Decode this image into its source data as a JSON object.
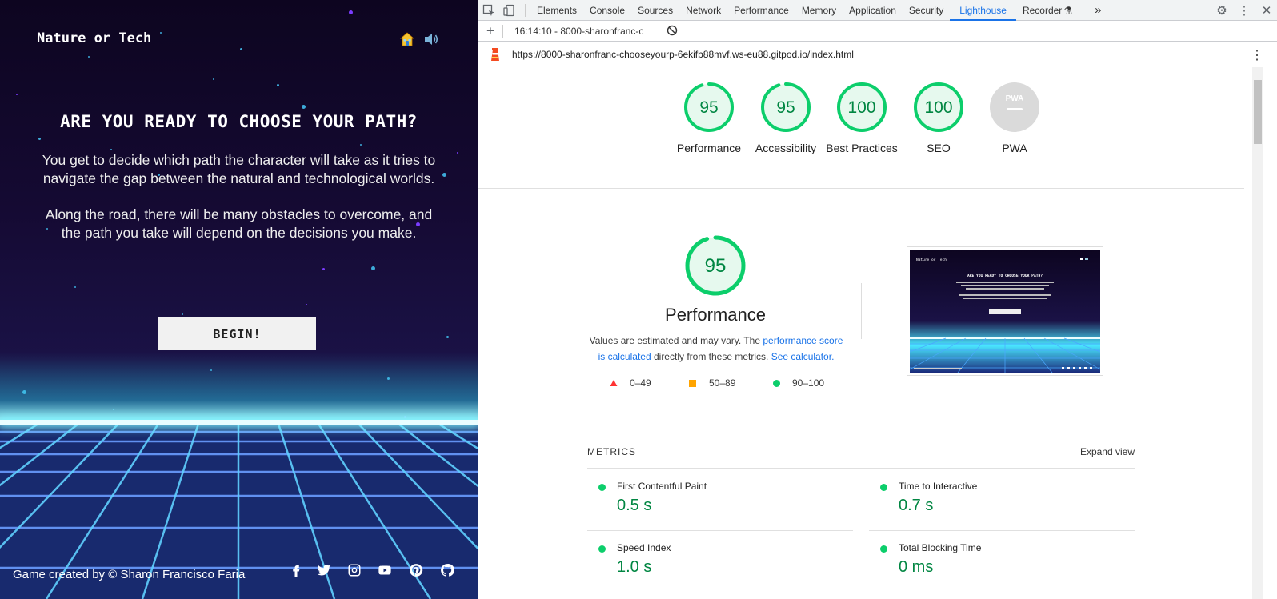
{
  "game": {
    "logo": "Nature or Tech",
    "title": "ARE YOU READY TO CHOOSE YOUR PATH?",
    "intro_p1": "You get to decide which path the character will take as it tries to navigate the gap between the natural and technological worlds.",
    "intro_p2": "Along the road, there will be many obstacles to overcome, and the path you take will depend on the decisions you make.",
    "begin_label": "BEGIN!",
    "footer": "Game created by © Sharon Francisco Faria",
    "social_icons": [
      "facebook-icon",
      "twitter-icon",
      "instagram-icon",
      "youtube-icon",
      "pinterest-icon",
      "github-icon"
    ]
  },
  "devtools": {
    "tabs": [
      "Elements",
      "Console",
      "Sources",
      "Network",
      "Performance",
      "Memory",
      "Application",
      "Security",
      "Lighthouse",
      "Recorder"
    ],
    "active_tab": "Lighthouse",
    "more_tabs": "»",
    "report_select": "16:14:10 - 8000-sharonfranc-c",
    "url": "https://8000-sharonfranc-chooseyourp-6ekifb88mvf.ws-eu88.gitpod.io/index.html"
  },
  "scores": [
    {
      "score": "95",
      "label": "Performance"
    },
    {
      "score": "95",
      "label": "Accessibility"
    },
    {
      "score": "100",
      "label": "Best Practices"
    },
    {
      "score": "100",
      "label": "SEO"
    },
    {
      "score": "",
      "label": "PWA",
      "badge": "PWA"
    }
  ],
  "performance": {
    "score": "95",
    "title": "Performance",
    "desc_pre": "Values are estimated and may vary. The ",
    "desc_link1": "performance score is calculated",
    "desc_mid": " directly from these metrics. ",
    "desc_link2": "See calculator.",
    "legend": [
      "0–49",
      "50–89",
      "90–100"
    ]
  },
  "metrics": {
    "heading": "METRICS",
    "expand": "Expand view",
    "items": [
      {
        "name": "First Contentful Paint",
        "value": "0.5 s"
      },
      {
        "name": "Time to Interactive",
        "value": "0.7 s"
      },
      {
        "name": "Speed Index",
        "value": "1.0 s"
      },
      {
        "name": "Total Blocking Time",
        "value": "0 ms"
      }
    ]
  },
  "colors": {
    "pass": "#0cce6b",
    "pass_text": "#018642",
    "pass_bg": "#e6f9ee",
    "fail": "#ff3333",
    "average": "#ffa400",
    "link": "#1a73e8"
  }
}
